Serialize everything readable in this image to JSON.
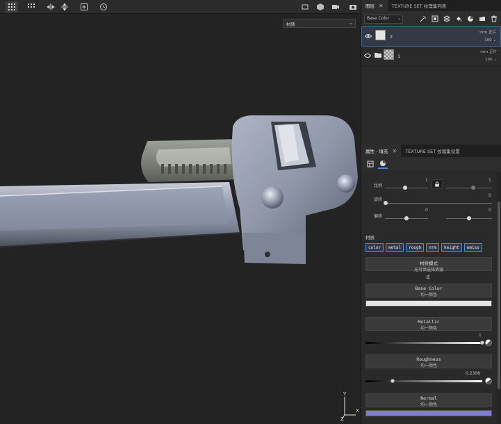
{
  "viewport": {
    "dropdown": "材质",
    "axis": {
      "y": "Y",
      "x": "X",
      "z": "Z"
    }
  },
  "layers": {
    "tabs": [
      {
        "label": "图层"
      },
      {
        "label": "TEXTURE SET 纹理集列表"
      }
    ],
    "blend_select": "Base Color",
    "items": [
      {
        "name": "2",
        "mode": "nrm 正片",
        "opacity": "100 ⌄"
      },
      {
        "name": "1",
        "mode": "nrm 正片",
        "opacity": "100 ⌄"
      }
    ]
  },
  "properties": {
    "tabs": [
      {
        "label": "属性 - 填充"
      },
      {
        "label": "TEXTURE SET 纹理集设置"
      }
    ],
    "uv": {
      "scale_label": "比例",
      "scale_value_left": "1",
      "scale_value_right": "1",
      "rotation_label": "旋转",
      "rotation_value": "0",
      "offset_label": "偏移",
      "offset_value_left": "0",
      "offset_value_right": "0"
    },
    "material_section": "材质",
    "channels": [
      "color",
      "metal",
      "rough",
      "nrm",
      "height",
      "emiss"
    ],
    "material_mode": {
      "title": "材质模式",
      "value": "无可供选择资源"
    },
    "or_label": "或",
    "base_color": {
      "title": "Base Color",
      "sub": "均一颜色",
      "color": "#e6e6e6"
    },
    "metallic": {
      "title": "Metallic",
      "sub": "均一颜色",
      "value": "1",
      "fraction": 1.0
    },
    "roughness": {
      "title": "Roughness",
      "sub": "均一颜色",
      "value": "0.2308",
      "fraction": 0.2308
    },
    "normal": {
      "title": "Normal",
      "sub": "均一颜色",
      "color": "#7f7fd0"
    }
  }
}
